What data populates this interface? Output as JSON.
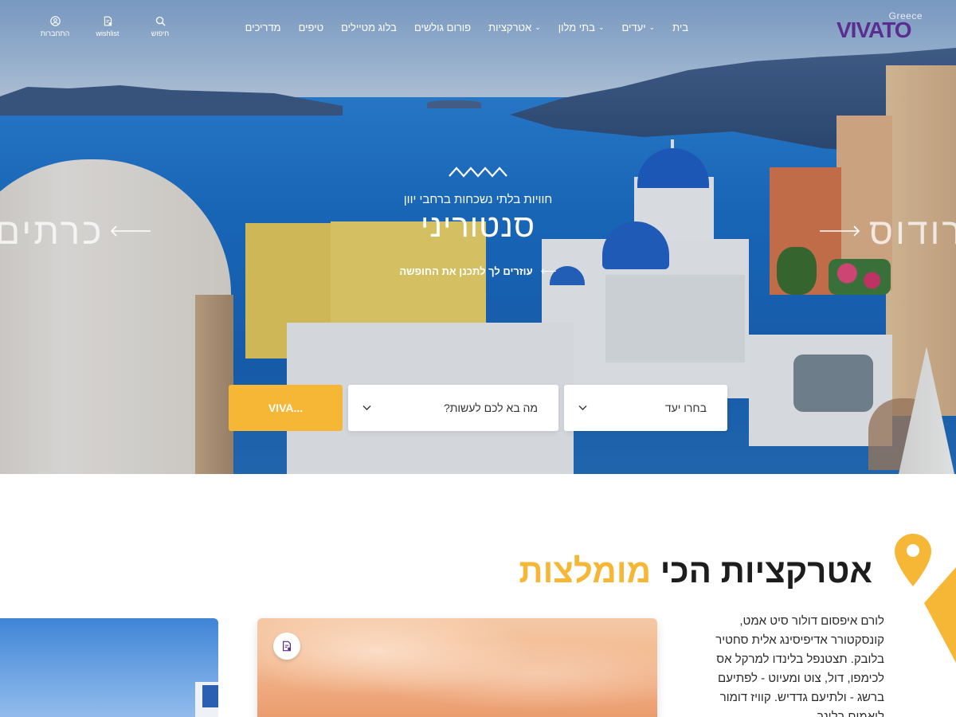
{
  "header": {
    "logo": {
      "country": "Greece",
      "name": "VIVATO"
    },
    "nav": [
      {
        "label": "בית",
        "has_dropdown": false
      },
      {
        "label": "יעדים",
        "has_dropdown": true
      },
      {
        "label": "בתי מלון",
        "has_dropdown": true
      },
      {
        "label": "אטרקציות",
        "has_dropdown": true
      },
      {
        "label": "פורום גולשים",
        "has_dropdown": false
      },
      {
        "label": "בלוג מטיילים",
        "has_dropdown": false
      },
      {
        "label": "טיפים",
        "has_dropdown": false
      },
      {
        "label": "מדריכים",
        "has_dropdown": false
      }
    ],
    "tools": {
      "search": {
        "label": "חיפוש",
        "icon": "search-icon"
      },
      "wishlist": {
        "label": "wishlist",
        "icon": "document-icon"
      },
      "login": {
        "label": "התחברות",
        "icon": "user-icon"
      }
    }
  },
  "hero": {
    "subtitle": "חוויות בלתי נשכחות ברחבי יוון",
    "title": "סנטוריני",
    "cta": "עוזרים לך לתכנן את החופשה",
    "prev_destination": "כרתים",
    "next_destination": "רודוס"
  },
  "search": {
    "destination_label": "בחרו יעד",
    "activity_label": "מה בא לכם לעשות?",
    "submit_label": "VIVA..."
  },
  "section": {
    "title_main": "אטרקציות הכי ",
    "title_highlight": "מומלצות",
    "body": "לורם איפסום דולור סיט אמט, קונסקטורר אדיפיסינג אלית סחטיר בלובק. תצטנפל בלינדו למרקל אס לכימפו, דול, צוט ומעיוט - לפתיעם ברשג - ולתיעם גדדיש. קוויז דומור ליאמום בלינך"
  },
  "colors": {
    "accent": "#f6b736",
    "brand": "#5a2d8f",
    "text": "#1d1d1d"
  }
}
